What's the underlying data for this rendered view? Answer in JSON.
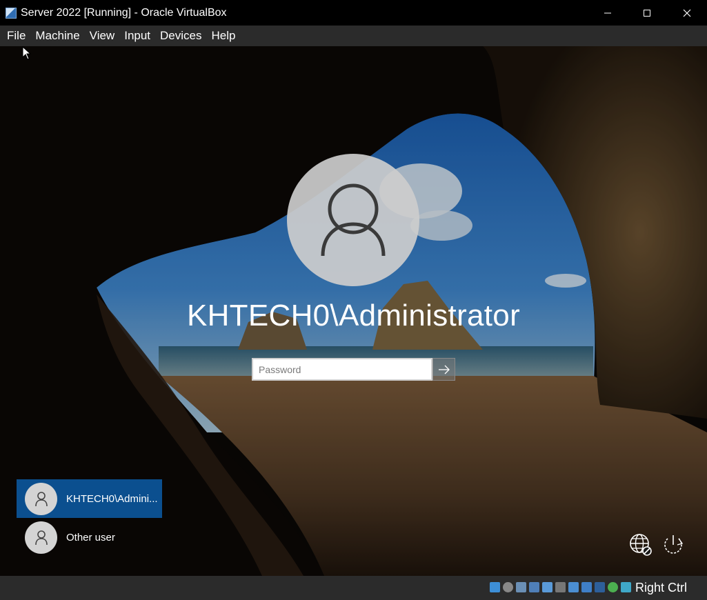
{
  "window": {
    "title": "Server 2022 [Running] - Oracle VirtualBox"
  },
  "menu": {
    "items": [
      "File",
      "Machine",
      "View",
      "Input",
      "Devices",
      "Help"
    ]
  },
  "login": {
    "username": "KHTECH0\\Administrator",
    "password_placeholder": "Password",
    "submit_icon": "arrow-right-icon"
  },
  "user_list": [
    {
      "label": "KHTECH0\\Admini...",
      "selected": true
    },
    {
      "label": "Other user",
      "selected": false
    }
  ],
  "corner_icons": [
    "network-icon",
    "power-icon"
  ],
  "statusbar": {
    "host_key": "Right Ctrl",
    "icons": [
      "hdd-icon",
      "optical-icon",
      "audio-icon",
      "network-icon",
      "usb-icon",
      "shared-folders-icon",
      "display-icon",
      "recording-icon",
      "vt-x-icon",
      "mouse-integration-icon",
      "keyboard-icon"
    ]
  },
  "colors": {
    "selected_tile": "#0b4f8f",
    "menubar": "#2b2b2b"
  }
}
